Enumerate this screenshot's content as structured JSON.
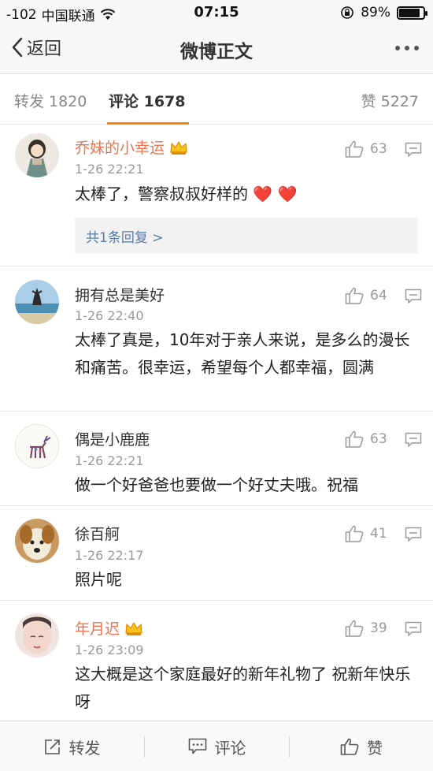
{
  "status": {
    "signal": "-102",
    "carrier": "中国联通",
    "time": "07:15",
    "battery": "89%",
    "battery_level": 0.89
  },
  "nav": {
    "back_label": "返回",
    "title": "微博正文"
  },
  "tabs": {
    "repost": "转发 1820",
    "comment": "评论 1678",
    "like": "赞 5227"
  },
  "comments": [
    {
      "username": "乔妹的小幸运",
      "vip": true,
      "timestamp": "1-26 22:21",
      "likes": "63",
      "text": "太棒了，警察叔叔好样的",
      "emoji": "❤️ ❤️",
      "replies": "共1条回复 >"
    },
    {
      "username": "拥有总是美好",
      "vip": false,
      "timestamp": "1-26 22:40",
      "likes": "64",
      "text": "太棒了真是，10年对于亲人来说，是多么的漫长和痛苦。很幸运，希望每个人都幸福，圆满"
    },
    {
      "username": "偶是小鹿鹿",
      "vip": false,
      "timestamp": "1-26 22:21",
      "likes": "63",
      "text": "做一个好爸爸也要做一个好丈夫哦。祝福"
    },
    {
      "username": "徐百舸",
      "vip": false,
      "timestamp": "1-26 22:17",
      "likes": "41",
      "text": "照片呢"
    },
    {
      "username": "年月迟",
      "vip": true,
      "timestamp": "1-26 23:09",
      "likes": "39",
      "text": "这大概是这个家庭最好的新年礼物了 祝新年快乐呀"
    }
  ],
  "bottom": {
    "repost": "转发",
    "comment": "评论",
    "like": "赞"
  },
  "colors": {
    "accent": "#ff8200",
    "vip_name": "#eb7350",
    "link": "#5a7ba8"
  }
}
